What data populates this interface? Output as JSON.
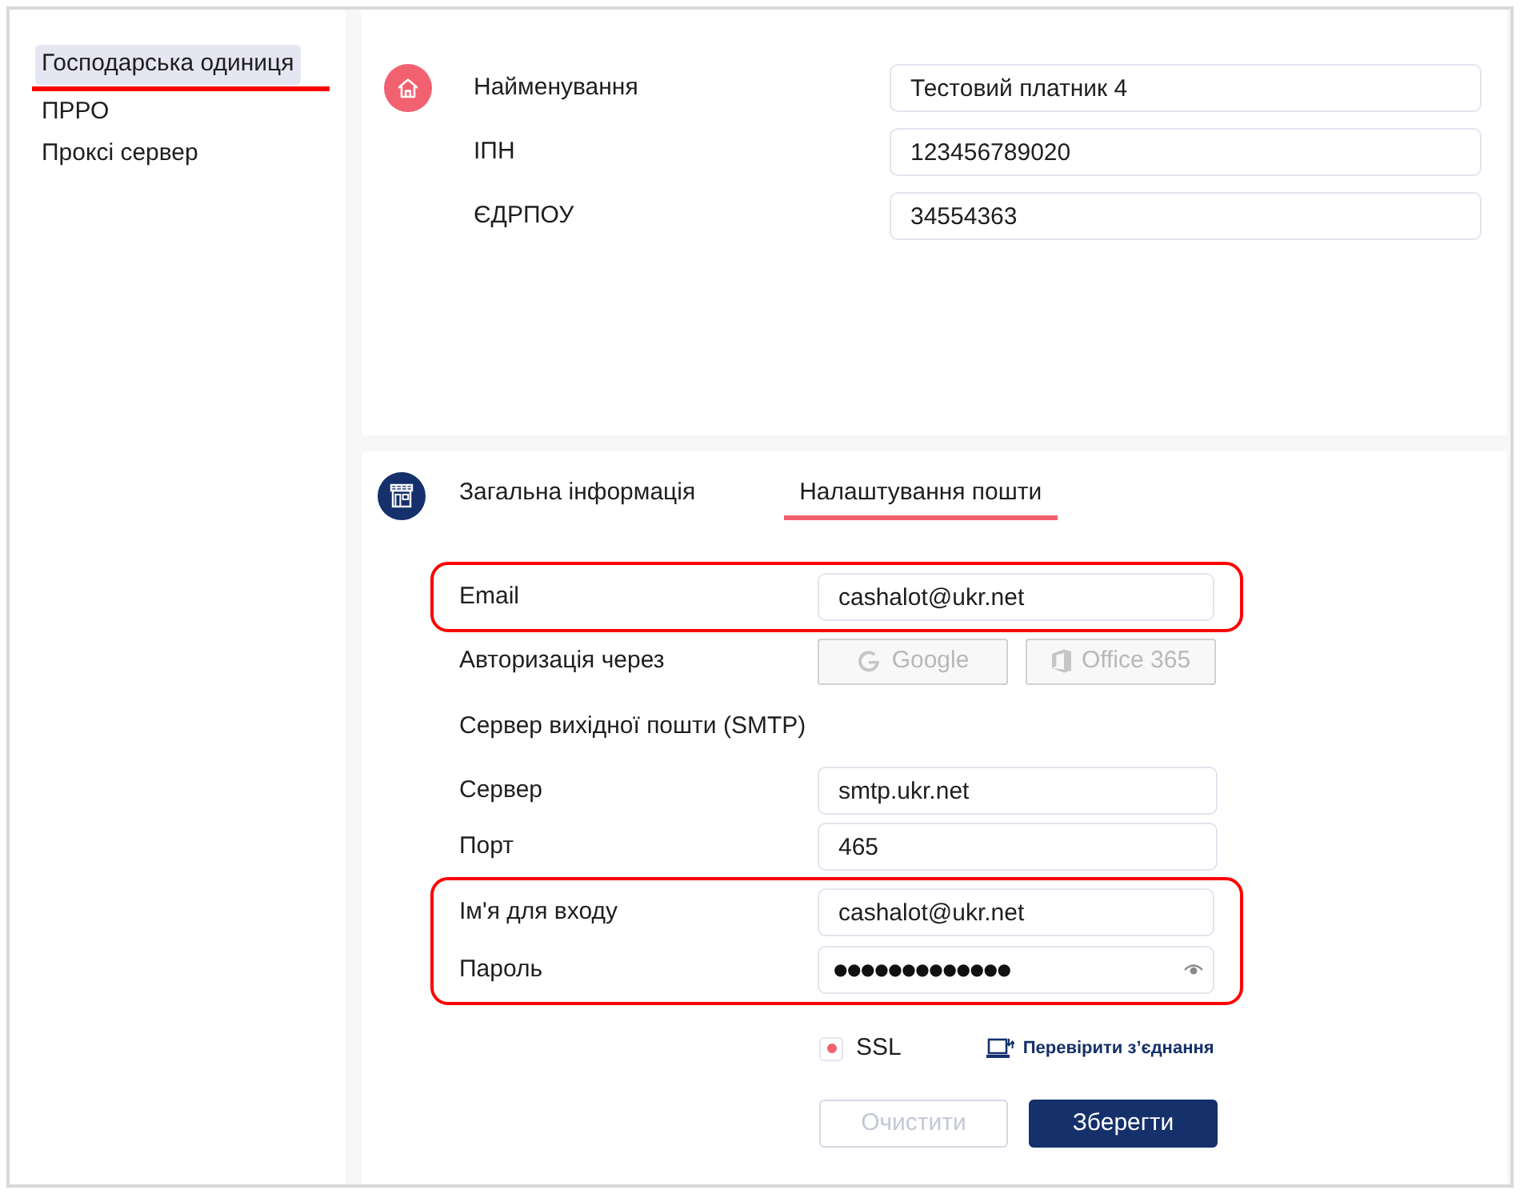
{
  "sidebar": {
    "items": [
      {
        "label": "Господарська одиниця",
        "selected": true,
        "underlined": true
      },
      {
        "label": "ПРРО",
        "selected": false,
        "underlined": false
      },
      {
        "label": "Проксі сервер",
        "selected": false,
        "underlined": false
      }
    ]
  },
  "business_unit": {
    "fields": [
      {
        "label": "Найменування",
        "value": "Тестовий платник 4"
      },
      {
        "label": "ІПН",
        "value": "123456789020"
      },
      {
        "label": "ЄДРПОУ",
        "value": "34554363"
      }
    ]
  },
  "tabs": [
    {
      "label": "Загальна інформація",
      "selected": false
    },
    {
      "label": "Налаштування пошти",
      "selected": true
    }
  ],
  "mail_form": {
    "groups": [
      {
        "highlighted": true,
        "rows": [
          {
            "kind": "field",
            "label": "Email",
            "value": "cashalot@ukr.net"
          }
        ]
      },
      {
        "highlighted": false,
        "rows": [
          {
            "kind": "auth",
            "label": "Авторизація через",
            "buttons": [
              {
                "kind": "google",
                "label": "Google",
                "disabled": true
              },
              {
                "kind": "office",
                "label": "Office 365",
                "disabled": true
              }
            ]
          },
          {
            "kind": "heading",
            "label": "Сервер вихідної пошти (SMTP)"
          },
          {
            "kind": "field",
            "label": "Сервер",
            "value": "smtp.ukr.net"
          },
          {
            "kind": "field",
            "label": "Порт",
            "value": "465"
          }
        ]
      },
      {
        "highlighted": true,
        "rows": [
          {
            "kind": "field",
            "label": "Ім'я для входу",
            "value": "cashalot@ukr.net"
          },
          {
            "kind": "password",
            "label": "Пароль",
            "value": "●●●●●●●●●●●●●"
          }
        ]
      }
    ],
    "ssl": {
      "label": "SSL",
      "checked": true
    },
    "test_link": {
      "label": "Перевірити з’єднання"
    },
    "buttons": [
      {
        "kind": "clear",
        "label": "Очистити",
        "disabled": true
      },
      {
        "kind": "save",
        "label": "Зберегти",
        "disabled": false
      }
    ]
  }
}
